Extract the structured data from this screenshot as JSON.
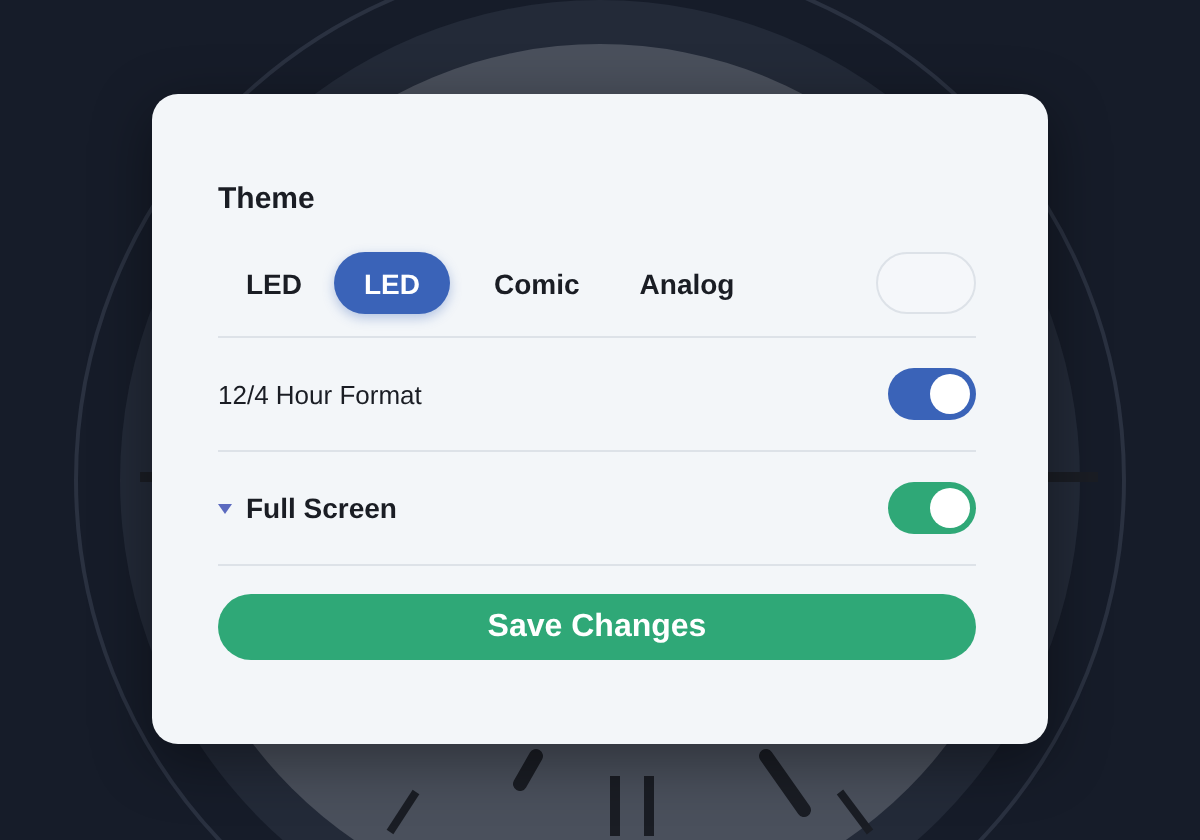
{
  "theme": {
    "title": "Theme",
    "options": [
      {
        "label": "LED",
        "selected": false
      },
      {
        "label": "LED",
        "selected": true
      },
      {
        "label": "Comic",
        "selected": false
      },
      {
        "label": "Analog",
        "selected": false
      }
    ]
  },
  "settings": [
    {
      "kind": "plain",
      "label": "12/4 Hour Format",
      "on": true,
      "color": "#3a63b8"
    },
    {
      "kind": "expandable",
      "label": "Full Screen",
      "on": true,
      "color": "#2fa877"
    }
  ],
  "save_button": "Save Changes"
}
